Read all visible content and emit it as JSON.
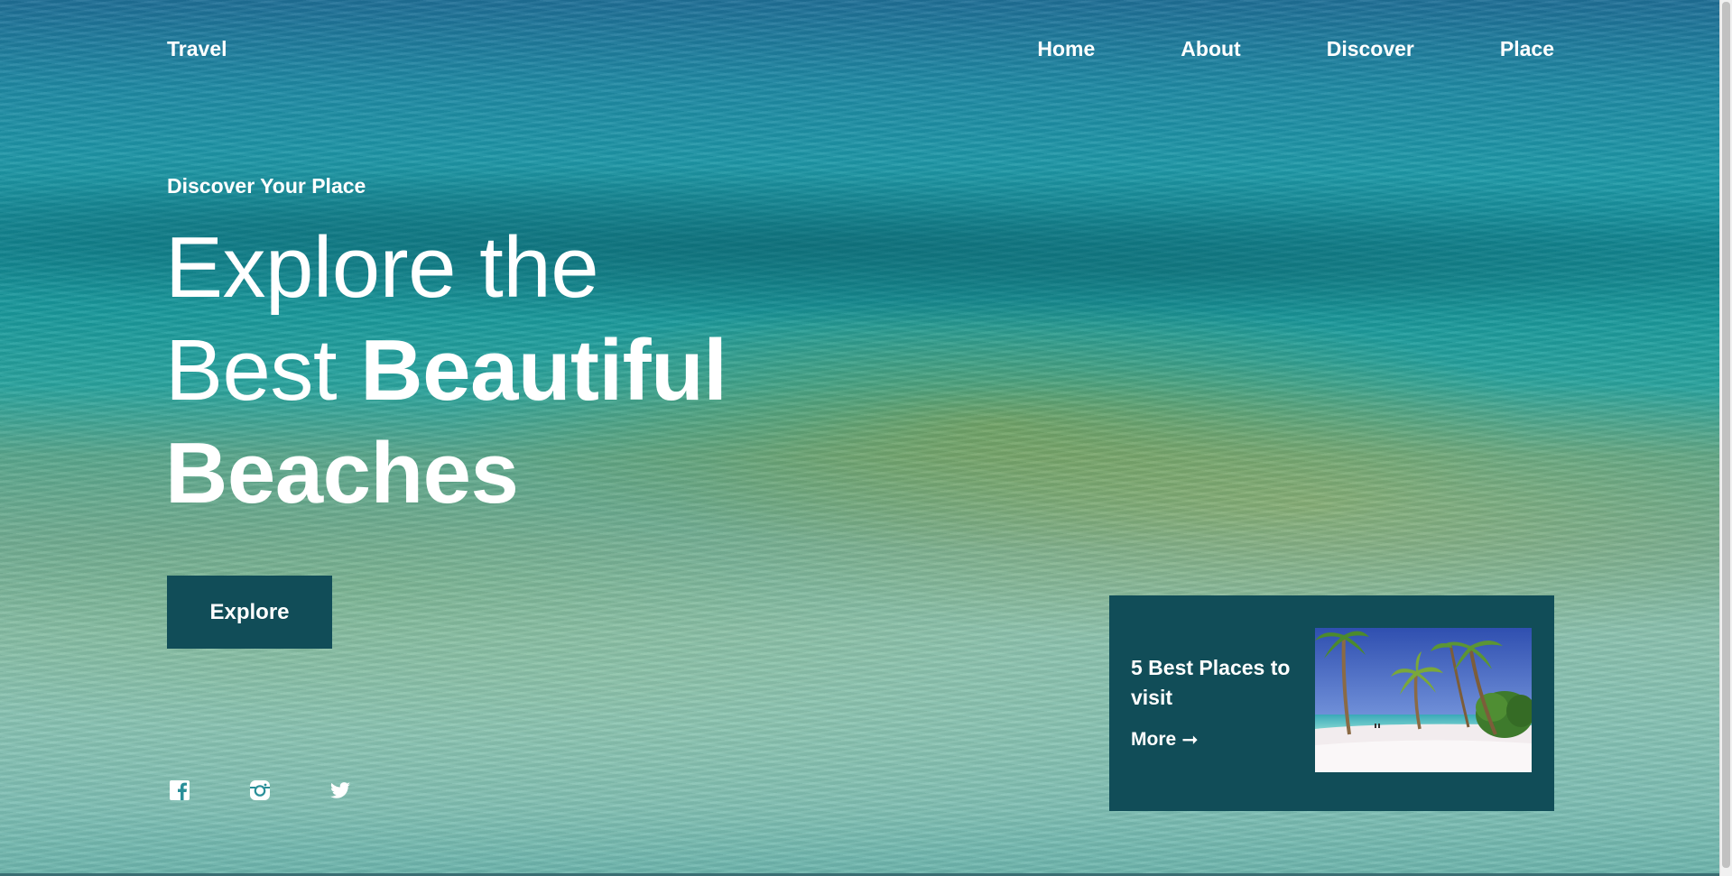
{
  "header": {
    "logo": "Travel",
    "nav": [
      {
        "label": "Home"
      },
      {
        "label": "About"
      },
      {
        "label": "Discover"
      },
      {
        "label": "Place"
      }
    ]
  },
  "hero": {
    "subtitle": "Discover Your Place",
    "title_line1": "Explore the",
    "title_line2_light": "Best",
    "title_line2_bold": "Beautiful",
    "title_line3": "Beaches",
    "button_label": "Explore"
  },
  "social": [
    {
      "icon": "facebook-icon"
    },
    {
      "icon": "instagram-icon"
    },
    {
      "icon": "twitter-icon"
    }
  ],
  "card": {
    "title": "5 Best Places to visit",
    "more_label": "More",
    "arrow_icon": "arrow-right-icon",
    "image": "beach-palm-trees-image"
  },
  "colors": {
    "accent": "#114d58",
    "text": "#ffffff"
  }
}
